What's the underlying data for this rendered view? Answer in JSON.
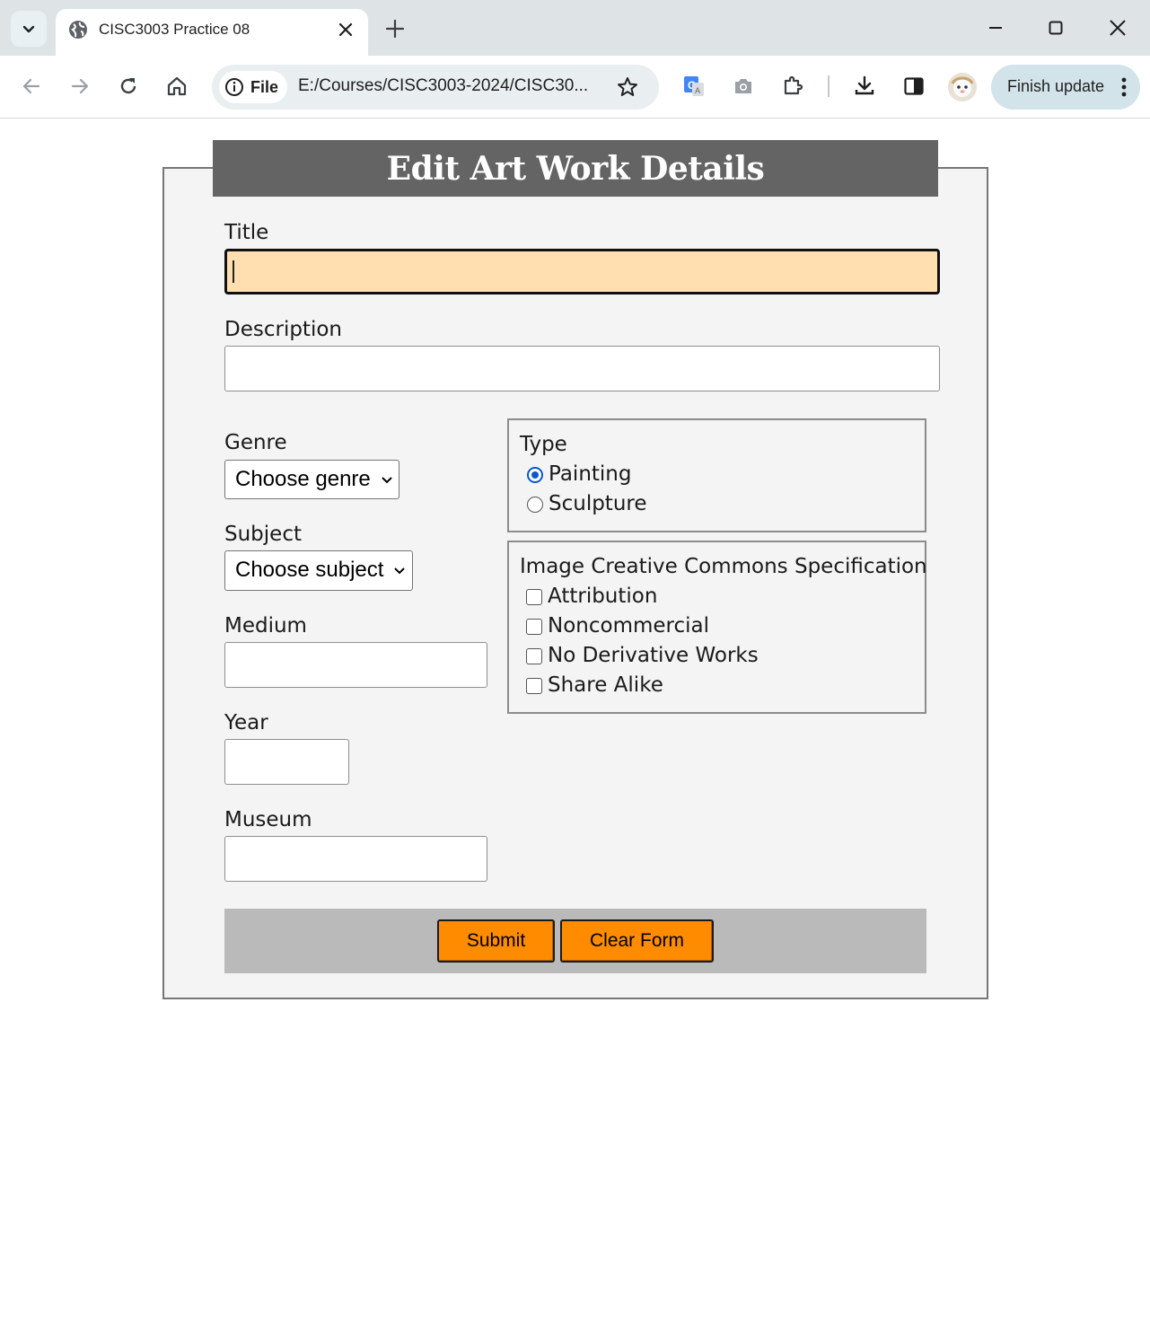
{
  "browser": {
    "tab_title": "CISC3003 Practice 08",
    "file_chip": "File",
    "url": "E:/Courses/CISC3003-2024/CISC30...",
    "finish_update": "Finish update"
  },
  "form": {
    "heading": "Edit Art Work Details",
    "title_label": "Title",
    "title_value": "",
    "description_label": "Description",
    "description_value": "",
    "genre_label": "Genre",
    "genre_selected": "Choose genre",
    "subject_label": "Subject",
    "subject_selected": "Choose subject",
    "medium_label": "Medium",
    "year_label": "Year",
    "museum_label": "Museum",
    "type": {
      "legend": "Type",
      "options": [
        {
          "label": "Painting",
          "checked": true
        },
        {
          "label": "Sculpture",
          "checked": false
        }
      ]
    },
    "license": {
      "legend": "Image Creative Commons Specification",
      "options": [
        {
          "label": "Attribution",
          "checked": false
        },
        {
          "label": "Noncommercial",
          "checked": false
        },
        {
          "label": "No Derivative Works",
          "checked": false
        },
        {
          "label": "Share Alike",
          "checked": false
        }
      ]
    },
    "submit_label": "Submit",
    "clear_label": "Clear Form"
  },
  "colors": {
    "heading_bg": "#646464",
    "title_input_bg": "#ffdfb0",
    "button_bg": "#ff8c00",
    "button_bar_bg": "#bababa",
    "radio_checked": "#0b57d0"
  }
}
